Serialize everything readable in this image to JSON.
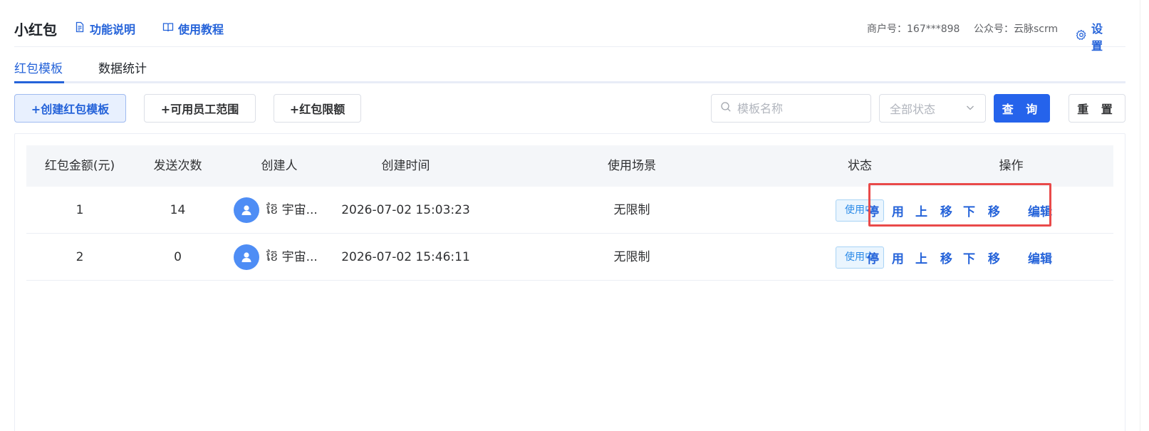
{
  "header": {
    "title": "小红包",
    "links": {
      "function_desc": "功能说明",
      "tutorial": "使用教程"
    },
    "merchant": "商户号：167***898",
    "account": "公众号：云脉scrm",
    "settings": "设 置"
  },
  "tabs": [
    {
      "label": "红包模板",
      "active": true
    },
    {
      "label": "数据统计",
      "active": false
    }
  ],
  "toolbar": {
    "create_label": "+创建红包模板",
    "staff_label": "+可用员工范围",
    "limit_label": "+红包限额",
    "search_placeholder": "模板名称",
    "status_select": "全部状态",
    "query_label": "查 询",
    "reset_label": "重 置"
  },
  "table": {
    "headers": [
      "红包金额(元)",
      "发送次数",
      "创建人",
      "创建时间",
      "使用场景",
      "状态",
      "操作"
    ],
    "rows": [
      {
        "amount": "1",
        "send_count": "14",
        "creator": "ខ៊ែ 宇宙...",
        "created_at": "2026-07-02 15:03:23",
        "scene": "无限制",
        "status": "使用中",
        "actions": {
          "stop": "停 用",
          "up": "上 移",
          "down": "下 移",
          "edit": "编辑"
        }
      },
      {
        "amount": "2",
        "send_count": "0",
        "creator": "ខ៊ែ 宇宙...",
        "created_at": "2026-07-02 15:46:11",
        "scene": "无限制",
        "status": "使用中",
        "actions": {
          "stop": "停 用",
          "up": "上 移",
          "down": "下 移",
          "edit": "编辑"
        }
      }
    ]
  },
  "colors": {
    "accent": "#2563d9",
    "primary_button": "#2563eb",
    "highlight_box": "#e94a4a",
    "badge_text": "#2a8ae8"
  }
}
